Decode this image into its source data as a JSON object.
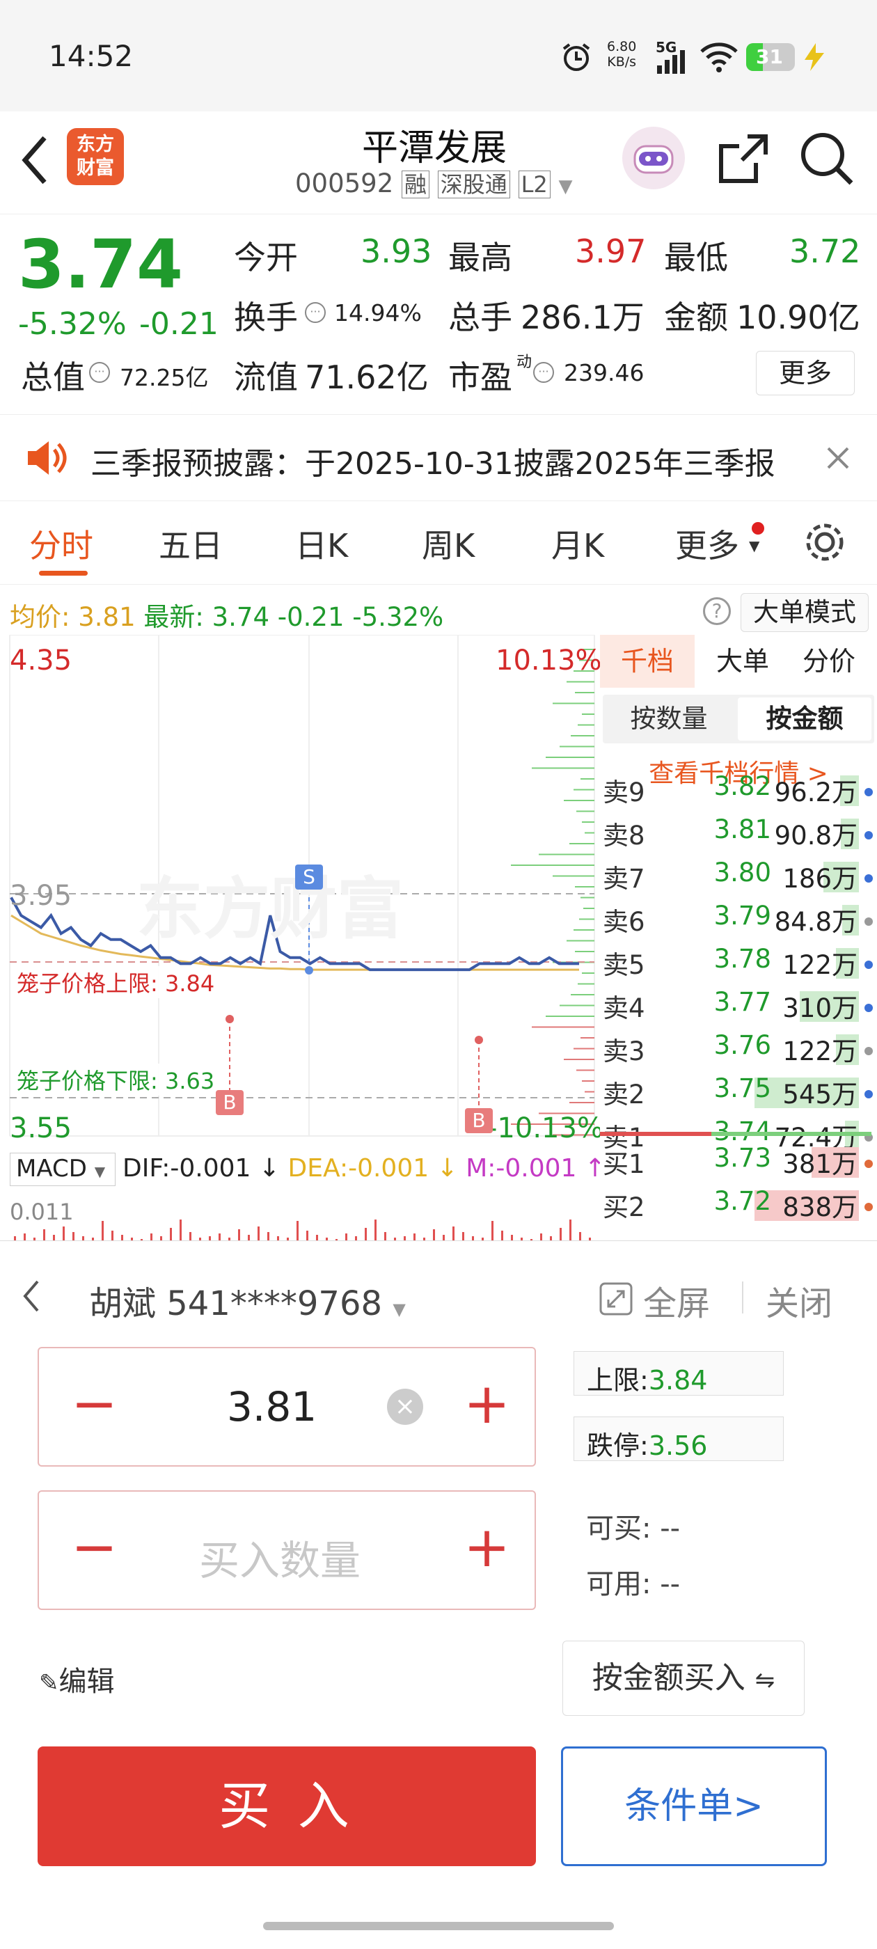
{
  "status_bar": {
    "time": "14:52",
    "net_speed_value": "6.80",
    "net_speed_unit": "KB/s",
    "signal": "5G",
    "battery": "31"
  },
  "header": {
    "logo_line1": "东方",
    "logo_line2": "财富",
    "stock_name": "平潭发展",
    "stock_code": "000592",
    "tag_margin": "融",
    "tag_connect": "深股通",
    "tag_level": "L2"
  },
  "quote": {
    "price": "3.74",
    "change_pct": "-5.32%",
    "change": "-0.21",
    "open_label": "今开",
    "open": "3.93",
    "high_label": "最高",
    "high": "3.97",
    "low_label": "最低",
    "low": "3.72",
    "turnover_label": "换手",
    "turnover": "14.94%",
    "volume_label": "总手",
    "volume": "286.1万",
    "amount_label": "金额",
    "amount": "10.90亿",
    "mktcap_label": "总值",
    "mktcap": "72.25亿",
    "float_label": "流值",
    "float": "71.62亿",
    "pe_label": "市盈",
    "pe_sup": "动",
    "pe": "239.46",
    "more_label": "更多"
  },
  "notice": {
    "text": "三季报预披露：于2025-10-31披露2025年三季报"
  },
  "tabs": [
    "分时",
    "五日",
    "日K",
    "周K",
    "月K",
    "更多"
  ],
  "infobar": {
    "avg_label": "均价:",
    "avg": "3.81",
    "latest_label": "最新:",
    "latest": "3.74",
    "latest_change": "-0.21",
    "latest_pct": "-5.32%",
    "mode_label": "大单模式"
  },
  "chart": {
    "ymax": "4.35",
    "ymax_pct": "10.13%",
    "ymin": "3.55",
    "ymin_pct": "-10.13%",
    "ref_price": "3.95",
    "cage_upper_label": "笼子价格上限: 3.84",
    "cage_lower_label": "笼子价格下限: 3.63",
    "watermark": "东方财富",
    "marker_sell": "S",
    "marker_buy": "B",
    "macd_label": "MACD",
    "dif": "DIF:-0.001",
    "dea": "DEA:-0.001",
    "m": "M:-0.001",
    "macd_top": "0.011",
    "price_series": [
      3.93,
      3.9,
      3.89,
      3.88,
      3.9,
      3.87,
      3.88,
      3.86,
      3.85,
      3.87,
      3.86,
      3.86,
      3.85,
      3.84,
      3.85,
      3.83,
      3.83,
      3.82,
      3.82,
      3.83,
      3.82,
      3.82,
      3.83,
      3.82,
      3.83,
      3.82,
      3.9,
      3.84,
      3.83,
      3.83,
      3.82,
      3.83,
      3.82,
      3.82,
      3.82,
      3.82,
      3.81,
      3.81,
      3.81,
      3.81,
      3.81,
      3.81,
      3.81,
      3.81,
      3.81,
      3.81,
      3.81,
      3.82,
      3.82,
      3.82,
      3.82,
      3.83,
      3.82,
      3.82,
      3.83,
      3.82,
      3.82,
      3.82
    ],
    "avg_series": [
      3.9,
      3.89,
      3.88,
      3.87,
      3.865,
      3.86,
      3.855,
      3.85,
      3.846,
      3.842,
      3.839,
      3.836,
      3.834,
      3.832,
      3.83,
      3.828,
      3.826,
      3.824,
      3.822,
      3.82,
      3.818,
      3.817,
      3.816,
      3.815,
      3.814,
      3.813,
      3.812,
      3.812,
      3.811,
      3.811,
      3.81,
      3.81,
      3.81,
      3.81,
      3.81,
      3.81,
      3.81,
      3.81,
      3.81,
      3.81,
      3.81,
      3.81,
      3.81,
      3.81,
      3.81,
      3.81,
      3.81,
      3.81,
      3.81,
      3.81,
      3.81,
      3.81,
      3.81,
      3.81,
      3.81,
      3.81,
      3.81,
      3.81
    ]
  },
  "book": {
    "tab_qiandang": "千档",
    "tab_dadan": "大单",
    "tab_fenjia": "分价",
    "by_qty": "按数量",
    "by_amt": "按金额",
    "view_link": "查看千档行情 >",
    "sells": [
      {
        "label": "卖9",
        "price": "3.82",
        "vol": "96.2万",
        "fill": 0.18
      },
      {
        "label": "卖8",
        "price": "3.81",
        "vol": "90.8万",
        "fill": 0.17
      },
      {
        "label": "卖7",
        "price": "3.80",
        "vol": "186万",
        "fill": 0.34
      },
      {
        "label": "卖6",
        "price": "3.79",
        "vol": "84.8万",
        "fill": 0.16
      },
      {
        "label": "卖5",
        "price": "3.78",
        "vol": "122万",
        "fill": 0.22
      },
      {
        "label": "卖4",
        "price": "3.77",
        "vol": "310万",
        "fill": 0.57
      },
      {
        "label": "卖3",
        "price": "3.76",
        "vol": "122万",
        "fill": 0.22
      },
      {
        "label": "卖2",
        "price": "3.75",
        "vol": "545万",
        "fill": 1.0
      },
      {
        "label": "卖1",
        "price": "3.74",
        "vol": "72.4万",
        "fill": 0.13
      }
    ],
    "buys": [
      {
        "label": "买1",
        "price": "3.73",
        "vol": "381万",
        "fill": 0.45
      },
      {
        "label": "买2",
        "price": "3.72",
        "vol": "838万",
        "fill": 1.0
      }
    ]
  },
  "trade": {
    "account": "胡斌 541****9768",
    "fullscreen": "全屏",
    "close": "关闭",
    "price_value": "3.81",
    "qty_placeholder": "买入数量",
    "upper_label": "上限:",
    "upper": "3.84",
    "limitdown_label": "跌停:",
    "limitdown": "3.56",
    "canbuy_label": "可买:",
    "canbuy": "--",
    "available_label": "可用:",
    "available": "--",
    "edit": "编辑",
    "by_amount_buy": "按金额买入",
    "buy_button": "买 入",
    "conditional": "条件单>"
  }
}
